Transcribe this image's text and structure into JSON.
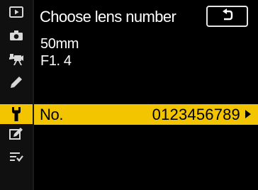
{
  "menu": {
    "tabs": [
      {
        "name": "playback-tab",
        "icon": "playback-icon",
        "active": false
      },
      {
        "name": "photo-shooting-tab",
        "icon": "camera-icon",
        "active": false
      },
      {
        "name": "movie-shooting-tab",
        "icon": "movie-camera-icon",
        "active": false
      },
      {
        "name": "custom-settings-tab",
        "icon": "pencil-icon",
        "active": false
      },
      {
        "name": "setup-tab",
        "icon": "wrench-icon",
        "active": true
      },
      {
        "name": "retouch-tab",
        "icon": "retouch-icon",
        "active": false
      },
      {
        "name": "my-menu-tab",
        "icon": "my-menu-icon",
        "active": false
      }
    ],
    "active_color": "#f2c500"
  },
  "header": {
    "title": "Choose lens number",
    "back_icon": "return-icon"
  },
  "lens_info": {
    "focal_length": "50mm",
    "aperture": "F1. 4"
  },
  "lens_number_row": {
    "label": "No.",
    "value": "0123456789",
    "arrow_icon": "right-arrow-icon"
  }
}
